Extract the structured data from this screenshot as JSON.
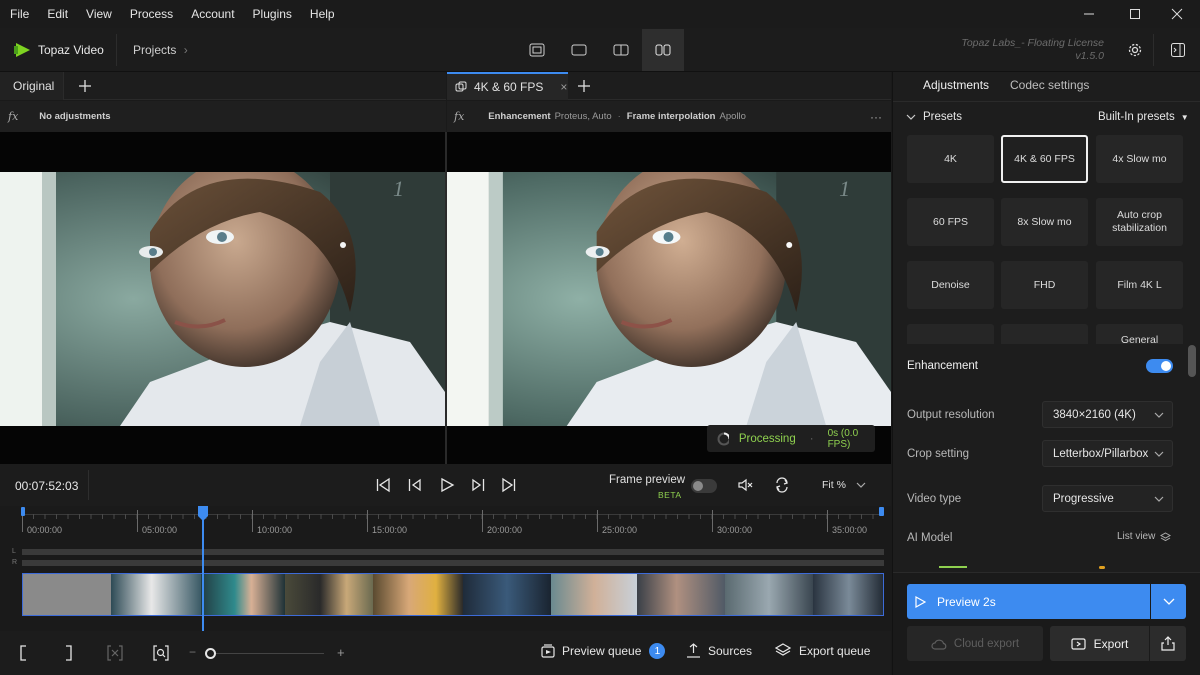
{
  "menu": [
    "File",
    "Edit",
    "View",
    "Process",
    "Account",
    "Plugins",
    "Help"
  ],
  "app": {
    "name": "Topaz Video",
    "projects": "Projects",
    "license_line1": "Topaz Labs_- Floating License",
    "license_line2": "v1.5.0"
  },
  "tabs": {
    "left": "Original",
    "right": "4K & 60 FPS"
  },
  "adjustments": {
    "left_text": "No adjustments",
    "enh_label": "Enhancement",
    "enh_value": "Proteus, Auto",
    "fi_label": "Frame interpolation",
    "fi_value": "Apollo",
    "more": "···"
  },
  "processing": {
    "label": "Processing",
    "stats": "0s (0.0 FPS)"
  },
  "controls": {
    "timecode": "00:07:52:03",
    "frame_preview": "Frame preview",
    "beta": "BETA",
    "fit": "Fit %"
  },
  "timeline": {
    "ticks": [
      "00:00:00",
      "05:00:00",
      "10:00:00",
      "15:00:00",
      "20:00:00",
      "25:00:00",
      "30:00:00",
      "35:00:00"
    ],
    "track_l": "L",
    "track_r": "R"
  },
  "bottom": {
    "preview_queue": "Preview queue",
    "queue_count": "1",
    "sources": "Sources",
    "export_queue": "Export queue"
  },
  "panel": {
    "tab_adjustments": "Adjustments",
    "tab_codec": "Codec settings",
    "presets_title": "Presets",
    "presets_menu": "Built-In presets",
    "presets": [
      "4K",
      "4K & 60 FPS",
      "4x Slow mo",
      "60 FPS",
      "8x Slow mo",
      "Auto crop stabilization",
      "Denoise",
      "FHD",
      "Film 4K L",
      "",
      "",
      "General"
    ],
    "enhancement": "Enhancement",
    "output_resolution_label": "Output resolution",
    "output_resolution": "3840×2160 (4K)",
    "crop_label": "Crop setting",
    "crop": "Letterbox/Pillarbox",
    "video_type_label": "Video type",
    "video_type": "Progressive",
    "ai_model_label": "AI Model",
    "list_view": "List view",
    "preview_button": "Preview 2s",
    "cloud_export": "Cloud export",
    "export": "Export"
  },
  "colors": {
    "accent": "#3d8bf0",
    "processing": "#8fd14f",
    "logo": "#7ed321"
  }
}
